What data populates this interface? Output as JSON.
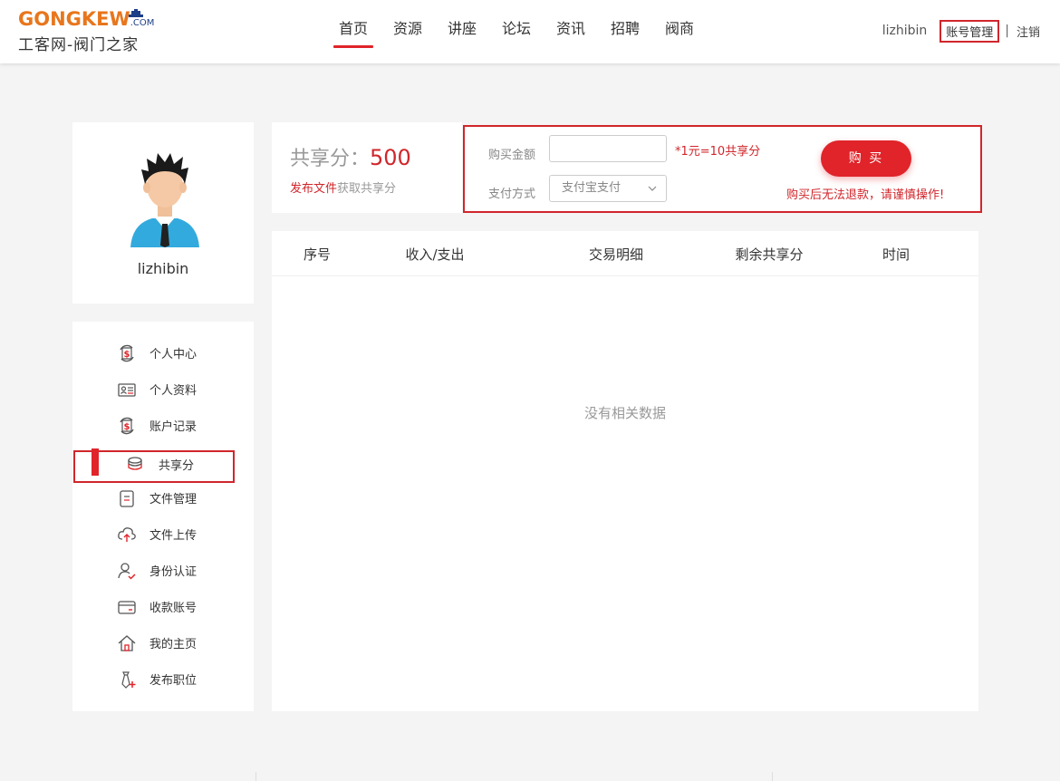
{
  "header": {
    "logo": {
      "brand_a": "GONGKEW",
      "brand_b": ".COM",
      "sub": "工客网-阀门之家"
    },
    "nav": [
      {
        "label": "首页",
        "active": true
      },
      {
        "label": "资源",
        "active": false
      },
      {
        "label": "讲座",
        "active": false
      },
      {
        "label": "论坛",
        "active": false
      },
      {
        "label": "资讯",
        "active": false
      },
      {
        "label": "招聘",
        "active": false
      },
      {
        "label": "阀商",
        "active": false
      }
    ],
    "username": "lizhibin",
    "account_manage": "账号管理",
    "separator": "|",
    "logout": "注销"
  },
  "profile": {
    "name": "lizhibin"
  },
  "sidebar": {
    "items": [
      {
        "label": "个人中心",
        "icon": "dollar-cycle-icon"
      },
      {
        "label": "个人资料",
        "icon": "id-card-icon"
      },
      {
        "label": "账户记录",
        "icon": "dollar-cycle-icon"
      },
      {
        "label": "共享分",
        "icon": "coin-stack-icon",
        "active": true
      },
      {
        "label": "文件管理",
        "icon": "clipboard-icon"
      },
      {
        "label": "文件上传",
        "icon": "cloud-upload-icon"
      },
      {
        "label": "身份认证",
        "icon": "user-check-icon"
      },
      {
        "label": "收款账号",
        "icon": "credit-card-icon"
      },
      {
        "label": "我的主页",
        "icon": "home-icon"
      },
      {
        "label": "发布职位",
        "icon": "tie-plus-icon"
      }
    ]
  },
  "points": {
    "label": "共享分：",
    "value": "500",
    "hint_link": "发布文件",
    "hint_text": "获取共享分"
  },
  "buy": {
    "amount_label": "购买金额",
    "amount_value": "",
    "rate": "*1元=10共享分",
    "pay_label": "支付方式",
    "pay_method": "支付宝支付",
    "button": "购 买",
    "warning": "购买后无法退款，请谨慎操作!"
  },
  "table": {
    "headers": [
      "序号",
      "收入/支出",
      "交易明细",
      "剩余共享分",
      "时间"
    ],
    "empty_text": "没有相关数据"
  },
  "colors": {
    "accent": "#e0242a",
    "logo_orange": "#e8761c",
    "logo_blue": "#1c3e87"
  }
}
